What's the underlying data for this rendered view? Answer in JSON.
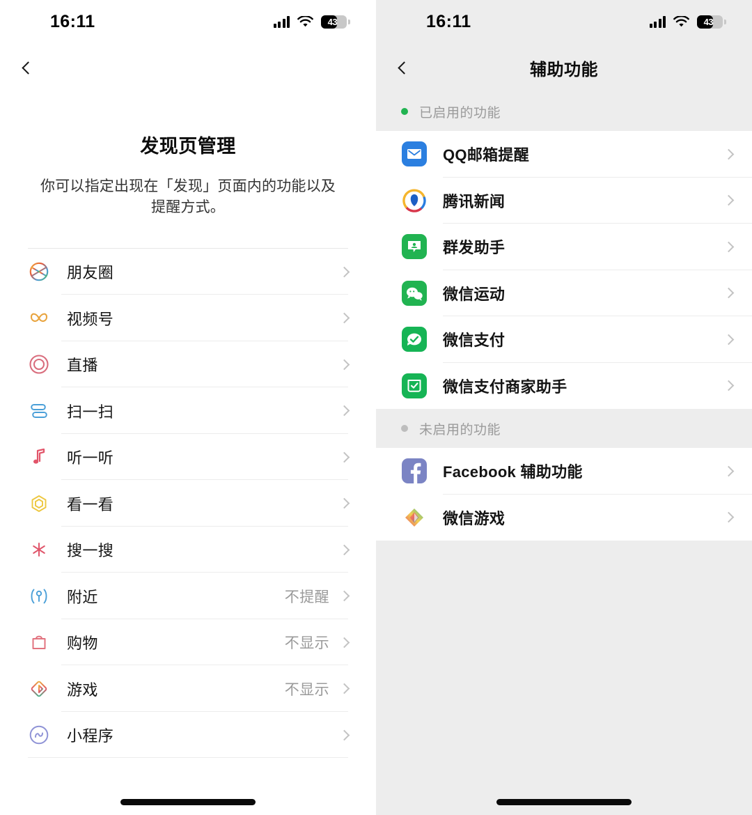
{
  "status_bar": {
    "time": "16:11",
    "signal_icon": "cellular-signal-icon",
    "wifi_icon": "wifi-icon",
    "battery_icon": "battery-icon",
    "battery_level": "43"
  },
  "left_screen": {
    "back_icon": "back-chevron-icon",
    "title": "发现页管理",
    "description": "你可以指定出现在「发现」页面内的功能以及提醒方式。",
    "items": [
      {
        "icon": "moments-icon",
        "label": "朋友圈",
        "value": ""
      },
      {
        "icon": "channels-icon",
        "label": "视频号",
        "value": ""
      },
      {
        "icon": "live-icon",
        "label": "直播",
        "value": ""
      },
      {
        "icon": "scan-icon",
        "label": "扫一扫",
        "value": ""
      },
      {
        "icon": "listen-icon",
        "label": "听一听",
        "value": ""
      },
      {
        "icon": "top-stories-icon",
        "label": "看一看",
        "value": ""
      },
      {
        "icon": "search-icon",
        "label": "搜一搜",
        "value": ""
      },
      {
        "icon": "nearby-icon",
        "label": "附近",
        "value": "不提醒"
      },
      {
        "icon": "shopping-icon",
        "label": "购物",
        "value": "不显示"
      },
      {
        "icon": "games-icon",
        "label": "游戏",
        "value": "不显示"
      },
      {
        "icon": "mini-programs-icon",
        "label": "小程序",
        "value": ""
      }
    ]
  },
  "right_screen": {
    "back_icon": "back-chevron-icon",
    "title": "辅助功能",
    "sections": [
      {
        "label": "已启用的功能",
        "dot_color": "#21b351",
        "items": [
          {
            "icon": "qq-mail-icon",
            "label": "QQ邮箱提醒"
          },
          {
            "icon": "tencent-news-icon",
            "label": "腾讯新闻"
          },
          {
            "icon": "group-assistant-icon",
            "label": "群发助手"
          },
          {
            "icon": "wechat-sports-icon",
            "label": "微信运动"
          },
          {
            "icon": "wechat-pay-icon",
            "label": "微信支付"
          },
          {
            "icon": "wechat-pay-merchant-icon",
            "label": "微信支付商家助手"
          }
        ]
      },
      {
        "label": "未启用的功能",
        "dot_color": "#bdbdbd",
        "items": [
          {
            "icon": "facebook-icon",
            "label": "Facebook 辅助功能"
          },
          {
            "icon": "wechat-games-icon",
            "label": "微信游戏"
          }
        ]
      }
    ]
  },
  "colors": {
    "right_bg": "#ededed",
    "list_bg": "#ffffff",
    "divider": "#ececec",
    "muted_text": "#9a9a9a",
    "enabled_dot": "#21b351",
    "disabled_dot": "#bdbdbd"
  }
}
